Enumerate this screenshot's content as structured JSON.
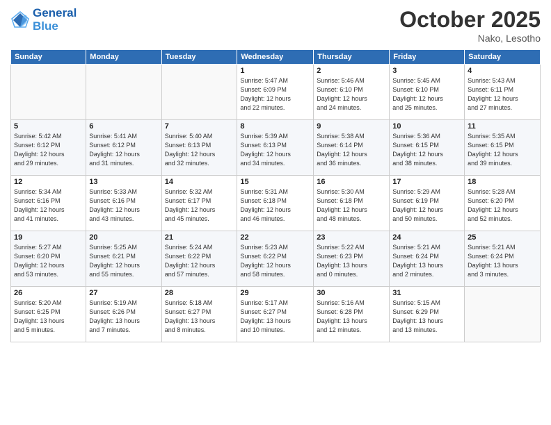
{
  "logo": {
    "line1": "General",
    "line2": "Blue"
  },
  "title": "October 2025",
  "location": "Nako, Lesotho",
  "days_of_week": [
    "Sunday",
    "Monday",
    "Tuesday",
    "Wednesday",
    "Thursday",
    "Friday",
    "Saturday"
  ],
  "weeks": [
    [
      {
        "day": "",
        "info": ""
      },
      {
        "day": "",
        "info": ""
      },
      {
        "day": "",
        "info": ""
      },
      {
        "day": "1",
        "info": "Sunrise: 5:47 AM\nSunset: 6:09 PM\nDaylight: 12 hours\nand 22 minutes."
      },
      {
        "day": "2",
        "info": "Sunrise: 5:46 AM\nSunset: 6:10 PM\nDaylight: 12 hours\nand 24 minutes."
      },
      {
        "day": "3",
        "info": "Sunrise: 5:45 AM\nSunset: 6:10 PM\nDaylight: 12 hours\nand 25 minutes."
      },
      {
        "day": "4",
        "info": "Sunrise: 5:43 AM\nSunset: 6:11 PM\nDaylight: 12 hours\nand 27 minutes."
      }
    ],
    [
      {
        "day": "5",
        "info": "Sunrise: 5:42 AM\nSunset: 6:12 PM\nDaylight: 12 hours\nand 29 minutes."
      },
      {
        "day": "6",
        "info": "Sunrise: 5:41 AM\nSunset: 6:12 PM\nDaylight: 12 hours\nand 31 minutes."
      },
      {
        "day": "7",
        "info": "Sunrise: 5:40 AM\nSunset: 6:13 PM\nDaylight: 12 hours\nand 32 minutes."
      },
      {
        "day": "8",
        "info": "Sunrise: 5:39 AM\nSunset: 6:13 PM\nDaylight: 12 hours\nand 34 minutes."
      },
      {
        "day": "9",
        "info": "Sunrise: 5:38 AM\nSunset: 6:14 PM\nDaylight: 12 hours\nand 36 minutes."
      },
      {
        "day": "10",
        "info": "Sunrise: 5:36 AM\nSunset: 6:15 PM\nDaylight: 12 hours\nand 38 minutes."
      },
      {
        "day": "11",
        "info": "Sunrise: 5:35 AM\nSunset: 6:15 PM\nDaylight: 12 hours\nand 39 minutes."
      }
    ],
    [
      {
        "day": "12",
        "info": "Sunrise: 5:34 AM\nSunset: 6:16 PM\nDaylight: 12 hours\nand 41 minutes."
      },
      {
        "day": "13",
        "info": "Sunrise: 5:33 AM\nSunset: 6:16 PM\nDaylight: 12 hours\nand 43 minutes."
      },
      {
        "day": "14",
        "info": "Sunrise: 5:32 AM\nSunset: 6:17 PM\nDaylight: 12 hours\nand 45 minutes."
      },
      {
        "day": "15",
        "info": "Sunrise: 5:31 AM\nSunset: 6:18 PM\nDaylight: 12 hours\nand 46 minutes."
      },
      {
        "day": "16",
        "info": "Sunrise: 5:30 AM\nSunset: 6:18 PM\nDaylight: 12 hours\nand 48 minutes."
      },
      {
        "day": "17",
        "info": "Sunrise: 5:29 AM\nSunset: 6:19 PM\nDaylight: 12 hours\nand 50 minutes."
      },
      {
        "day": "18",
        "info": "Sunrise: 5:28 AM\nSunset: 6:20 PM\nDaylight: 12 hours\nand 52 minutes."
      }
    ],
    [
      {
        "day": "19",
        "info": "Sunrise: 5:27 AM\nSunset: 6:20 PM\nDaylight: 12 hours\nand 53 minutes."
      },
      {
        "day": "20",
        "info": "Sunrise: 5:25 AM\nSunset: 6:21 PM\nDaylight: 12 hours\nand 55 minutes."
      },
      {
        "day": "21",
        "info": "Sunrise: 5:24 AM\nSunset: 6:22 PM\nDaylight: 12 hours\nand 57 minutes."
      },
      {
        "day": "22",
        "info": "Sunrise: 5:23 AM\nSunset: 6:22 PM\nDaylight: 12 hours\nand 58 minutes."
      },
      {
        "day": "23",
        "info": "Sunrise: 5:22 AM\nSunset: 6:23 PM\nDaylight: 13 hours\nand 0 minutes."
      },
      {
        "day": "24",
        "info": "Sunrise: 5:21 AM\nSunset: 6:24 PM\nDaylight: 13 hours\nand 2 minutes."
      },
      {
        "day": "25",
        "info": "Sunrise: 5:21 AM\nSunset: 6:24 PM\nDaylight: 13 hours\nand 3 minutes."
      }
    ],
    [
      {
        "day": "26",
        "info": "Sunrise: 5:20 AM\nSunset: 6:25 PM\nDaylight: 13 hours\nand 5 minutes."
      },
      {
        "day": "27",
        "info": "Sunrise: 5:19 AM\nSunset: 6:26 PM\nDaylight: 13 hours\nand 7 minutes."
      },
      {
        "day": "28",
        "info": "Sunrise: 5:18 AM\nSunset: 6:27 PM\nDaylight: 13 hours\nand 8 minutes."
      },
      {
        "day": "29",
        "info": "Sunrise: 5:17 AM\nSunset: 6:27 PM\nDaylight: 13 hours\nand 10 minutes."
      },
      {
        "day": "30",
        "info": "Sunrise: 5:16 AM\nSunset: 6:28 PM\nDaylight: 13 hours\nand 12 minutes."
      },
      {
        "day": "31",
        "info": "Sunrise: 5:15 AM\nSunset: 6:29 PM\nDaylight: 13 hours\nand 13 minutes."
      },
      {
        "day": "",
        "info": ""
      }
    ]
  ]
}
